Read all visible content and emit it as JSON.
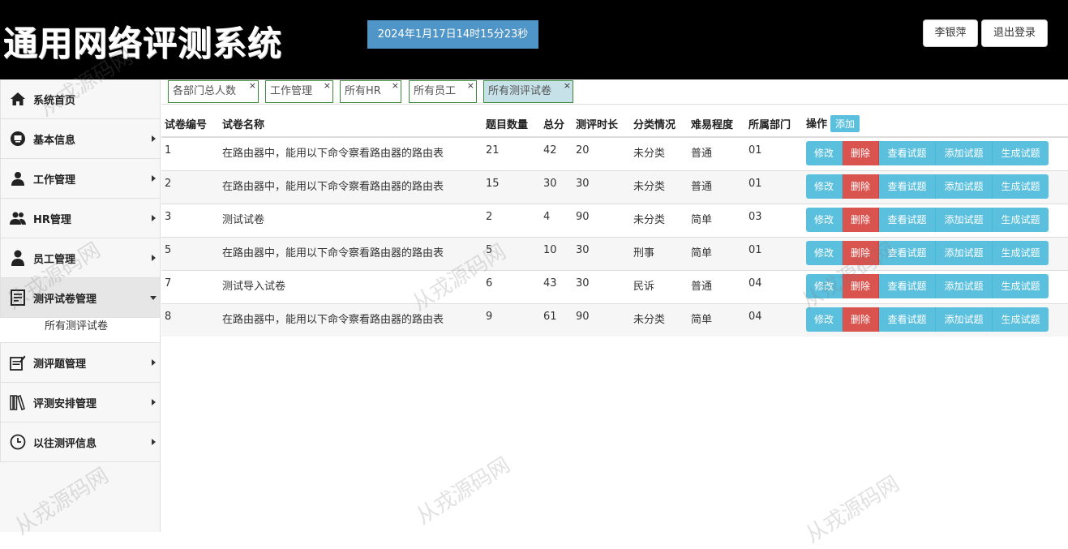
{
  "header": {
    "logo": "通用网络评测系统",
    "clock": "2024年1月17日14时15分23秒",
    "user": "李银萍",
    "logout": "退出登录"
  },
  "sidebar": {
    "items": [
      {
        "label": "系统首页",
        "icon": "home-icon"
      },
      {
        "label": "基本信息",
        "icon": "monitor-icon"
      },
      {
        "label": "工作管理",
        "icon": "user-icon"
      },
      {
        "label": "HR管理",
        "icon": "users-icon"
      },
      {
        "label": "员工管理",
        "icon": "user-icon"
      },
      {
        "label": "测评试卷管理",
        "icon": "document-icon"
      },
      {
        "label": "测评题管理",
        "icon": "edit-document-icon"
      },
      {
        "label": "评测安排管理",
        "icon": "books-icon"
      },
      {
        "label": "以往测评信息",
        "icon": "clock-icon"
      }
    ],
    "sub_item": "所有测评试卷"
  },
  "tabs": [
    {
      "label": "各部门总人数"
    },
    {
      "label": "工作管理"
    },
    {
      "label": "所有HR"
    },
    {
      "label": "所有员工"
    },
    {
      "label": "所有测评试卷"
    }
  ],
  "tab_close": "×",
  "table": {
    "headers": [
      "试卷编号",
      "试卷名称",
      "题目数量",
      "总分",
      "测评时长",
      "分类情况",
      "难易程度",
      "所属部门",
      "操作"
    ],
    "add_label": "添加",
    "rows": [
      {
        "id": "1",
        "name": "在路由器中，能用以下命令察看路由器的路由表",
        "count": "21",
        "score": "42",
        "duration": "20",
        "category": "未分类",
        "difficulty": "普通",
        "dept": "01"
      },
      {
        "id": "2",
        "name": "在路由器中，能用以下命令察看路由器的路由表",
        "count": "15",
        "score": "30",
        "duration": "30",
        "category": "未分类",
        "difficulty": "普通",
        "dept": "01"
      },
      {
        "id": "3",
        "name": "测试试卷",
        "count": "2",
        "score": "4",
        "duration": "90",
        "category": "未分类",
        "difficulty": "简单",
        "dept": "03"
      },
      {
        "id": "5",
        "name": "在路由器中，能用以下命令察看路由器的路由表",
        "count": "5",
        "score": "10",
        "duration": "30",
        "category": "刑事",
        "difficulty": "简单",
        "dept": "01"
      },
      {
        "id": "7",
        "name": "测试导入试卷",
        "count": "6",
        "score": "43",
        "duration": "30",
        "category": "民诉",
        "difficulty": "普通",
        "dept": "04"
      },
      {
        "id": "8",
        "name": "在路由器中，能用以下命令察看路由器的路由表",
        "count": "9",
        "score": "61",
        "duration": "90",
        "category": "未分类",
        "difficulty": "简单",
        "dept": "04"
      }
    ],
    "actions": [
      "修改",
      "删除",
      "查看试题",
      "添加试题",
      "生成试题"
    ]
  },
  "watermark": "从戎源码网",
  "colors": {
    "info": "#5bc0de",
    "danger": "#d9534f",
    "clock_bg": "#4f95c7",
    "active_tab": "#c6e1e8"
  }
}
